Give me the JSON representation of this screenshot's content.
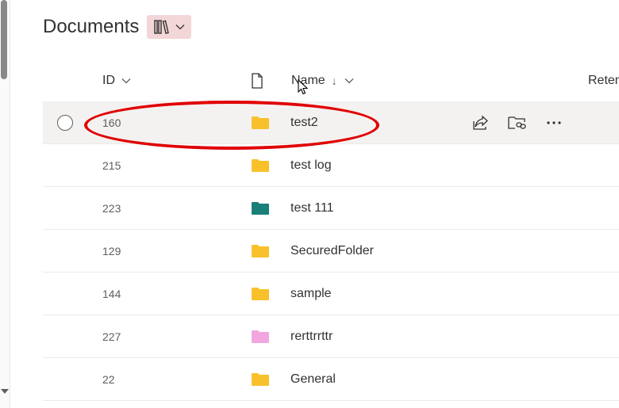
{
  "page": {
    "title": "Documents"
  },
  "header": {
    "id_label": "ID",
    "name_label": "Name",
    "name_sort": "↓",
    "retention_label": "Reten"
  },
  "rows": [
    {
      "id": "160",
      "name": "test2",
      "folder_color": "#f8c12c",
      "selected": true
    },
    {
      "id": "215",
      "name": "test log",
      "folder_color": "#f8c12c"
    },
    {
      "id": "223",
      "name": "test 111",
      "folder_color": "#1a7f79"
    },
    {
      "id": "129",
      "name": "SecuredFolder",
      "folder_color": "#f8c12c"
    },
    {
      "id": "144",
      "name": "sample",
      "folder_color": "#f8c12c"
    },
    {
      "id": "227",
      "name": "rerttrrttr",
      "folder_color": "#f2a6df"
    },
    {
      "id": "22",
      "name": "General",
      "folder_color": "#f8c12c"
    }
  ],
  "icons": {
    "view_switch": "library-icon",
    "type_header": "document-icon",
    "row_actions": [
      "share-icon",
      "copy-link-icon",
      "more-icon"
    ]
  },
  "colors": {
    "highlight_oval": "#e00000",
    "selected_row": "#f3f2f1",
    "view_switch_bg": "#f3d6d8"
  }
}
